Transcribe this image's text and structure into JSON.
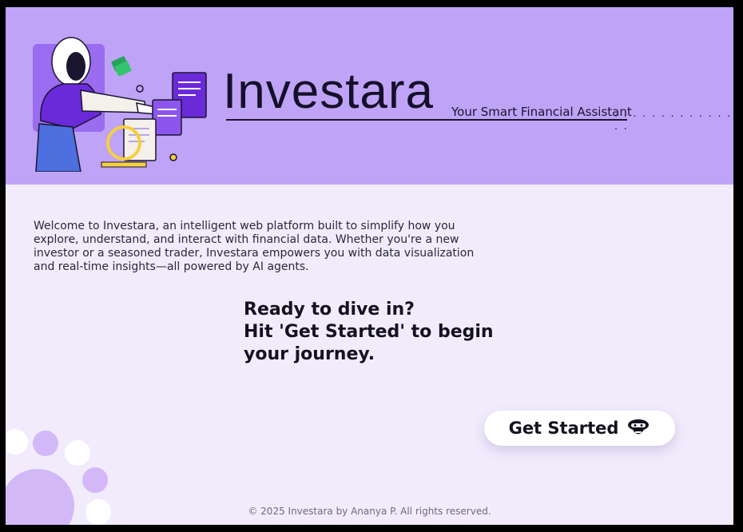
{
  "brand": {
    "name": "Investara",
    "tagline": "Your Smart Financial Assistant",
    "trailing_dots": ". . . . . . . . . . . . . . ."
  },
  "intro": {
    "text": "Welcome to Investara, an intelligent web platform built to simplify how you explore, understand, and interact with financial data. Whether you're a new investor or a seasoned trader, Investara empowers you with data visualization and real-time insights—all powered by AI agents."
  },
  "cta": {
    "line1": "Ready to dive in?",
    "line2": "Hit 'Get Started' to begin",
    "line3": "your journey.",
    "button_label": "Get Started",
    "button_icon": "robot-icon"
  },
  "footer": {
    "text": "© 2025 Investara by Ananya P. All rights reserved."
  },
  "colors": {
    "hero_bg": "#bfa3f6",
    "page_bg": "#f1ebfc",
    "accent_purple": "#7b3fe4",
    "text_dark": "#15121f"
  }
}
